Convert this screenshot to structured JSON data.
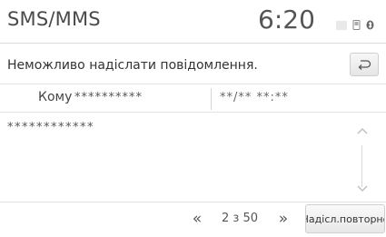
{
  "header": {
    "title": "SMS/MMS",
    "time": "6:20"
  },
  "message": {
    "error_text": "Неможливо надіслати повідомлення.",
    "to_label": "Кому",
    "to_value": "**********",
    "datetime": "**/** **:**",
    "body": "************"
  },
  "footer": {
    "prev_label": "«",
    "page": "2 з 50",
    "next_label": "»",
    "resend_label": "Надісл.повторно"
  }
}
